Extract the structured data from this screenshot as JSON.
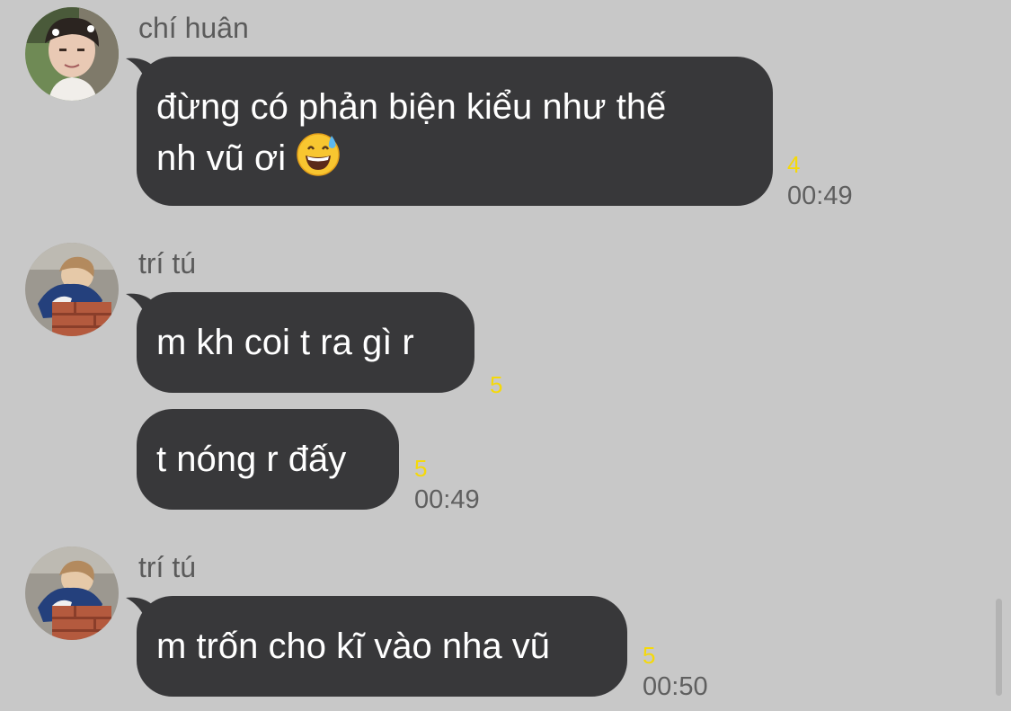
{
  "messages": [
    {
      "sender": "chí huân",
      "avatar": "avatar-chi-huan",
      "bubbles": [
        {
          "lines": [
            "đừng có phản biện kiểu như thế",
            "nh vũ ơi"
          ],
          "emoji": "grinning-face-with-sweat-icon",
          "read_count": "4",
          "time": "00:49"
        }
      ]
    },
    {
      "sender": "trí tú",
      "avatar": "avatar-tri-tu",
      "bubbles": [
        {
          "lines": [
            "m kh coi t ra gì r"
          ],
          "read_count": "5",
          "time": ""
        },
        {
          "lines": [
            "t nóng r đấy"
          ],
          "read_count": "5",
          "time": "00:49"
        }
      ]
    },
    {
      "sender": "trí tú",
      "avatar": "avatar-tri-tu",
      "bubbles": [
        {
          "lines": [
            "m trốn cho kĩ vào nha vũ"
          ],
          "read_count": "5",
          "time": "00:50"
        }
      ]
    }
  ],
  "colors": {
    "background": "#c8c8c8",
    "bubble": "#38383a",
    "bubble_text": "#ffffff",
    "sender_name": "#5b5b5b",
    "read_count": "#f5d90a",
    "time": "#5f5f5f"
  }
}
